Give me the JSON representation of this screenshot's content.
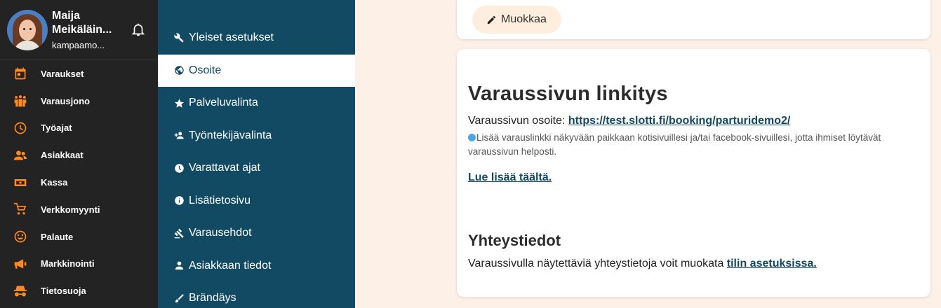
{
  "profile": {
    "name": "Maija Meikäläin...",
    "subtitle": "kampaamo..."
  },
  "sidebar": {
    "accent_color": "#ff8a1f",
    "items": [
      {
        "label": "Varaukset",
        "icon": "calendar-icon"
      },
      {
        "label": "Varausjono",
        "icon": "people-queue-icon"
      },
      {
        "label": "Työajat",
        "icon": "clock-icon"
      },
      {
        "label": "Asiakkaat",
        "icon": "customers-icon"
      },
      {
        "label": "Kassa",
        "icon": "cash-icon"
      },
      {
        "label": "Verkkomyynti",
        "icon": "shopping-cart-icon"
      },
      {
        "label": "Palaute",
        "icon": "smiley-icon"
      },
      {
        "label": "Markkinointi",
        "icon": "megaphone-icon"
      },
      {
        "label": "Tietosuoja",
        "icon": "incognito-icon"
      }
    ]
  },
  "submenu": {
    "bg_color": "#134a63",
    "items": [
      {
        "label": "Yleiset asetukset",
        "icon": "wrench-icon"
      },
      {
        "label": "Osoite",
        "icon": "globe-icon",
        "active": true
      },
      {
        "label": "Palveluvalinta",
        "icon": "star-icon"
      },
      {
        "label": "Työntekijävalinta",
        "icon": "add-person-icon"
      },
      {
        "label": "Varattavat ajat",
        "icon": "clock-icon"
      },
      {
        "label": "Lisätietosivu",
        "icon": "info-icon"
      },
      {
        "label": "Varausehdot",
        "icon": "gavel-icon"
      },
      {
        "label": "Asiakkaan tiedot",
        "icon": "person-icon"
      },
      {
        "label": "Brändäys",
        "icon": "brush-icon"
      }
    ]
  },
  "main": {
    "edit_label": "Muokkaa",
    "heading": "Varaussivun linkitys",
    "address_label": "Varaussivun osoite: ",
    "address_link": "https://test.slotti.fi/booking/parturidemo2/",
    "info_text": "Lisää varauslinkki näkyvään paikkaan kotisivuillesi ja/tai facebook-sivuillesi, jotta ihmiset löytävät varaussivun helposti.",
    "read_more": "Lue lisää täältä.",
    "contact_heading": "Yhteystiedot",
    "contact_text": "Varaussivulla näytettäviä yhteystietoja voit muokata ",
    "contact_link": "tilin asetuksissa."
  }
}
